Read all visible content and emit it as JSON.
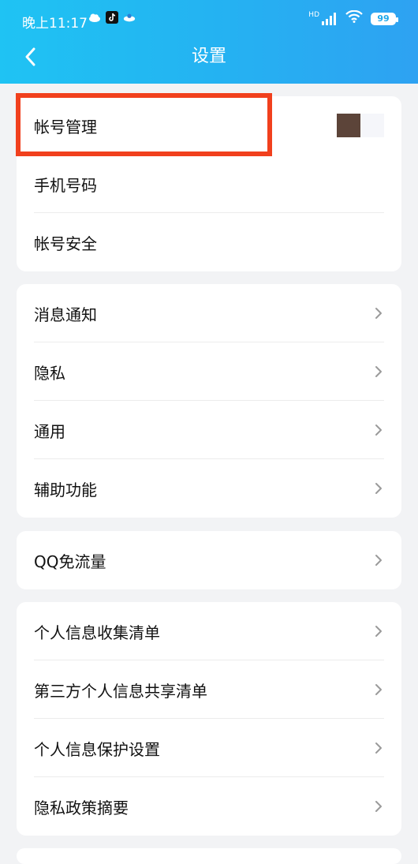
{
  "status": {
    "time": "晚上11:17",
    "battery": "99",
    "network": "HD"
  },
  "header": {
    "title": "设置"
  },
  "group1": [
    {
      "label": "帐号管理"
    },
    {
      "label": "手机号码"
    },
    {
      "label": "帐号安全"
    }
  ],
  "group2": [
    {
      "label": "消息通知"
    },
    {
      "label": "隐私"
    },
    {
      "label": "通用"
    },
    {
      "label": "辅助功能"
    }
  ],
  "group3": [
    {
      "label": "QQ免流量"
    }
  ],
  "group4": [
    {
      "label": "个人信息收集清单"
    },
    {
      "label": "第三方个人信息共享清单"
    },
    {
      "label": "个人信息保护设置"
    },
    {
      "label": "隐私政策摘要"
    }
  ],
  "colors": {
    "header_start": "#1fc3f3",
    "header_end": "#2ea2f2",
    "highlight": "#f1401d",
    "background": "#f2f3f5"
  },
  "icons": [
    "back-arrow-icon",
    "chevron-right-icon",
    "cloud-icon",
    "tiktok-icon",
    "signal-icon",
    "wifi-icon",
    "battery-icon"
  ]
}
